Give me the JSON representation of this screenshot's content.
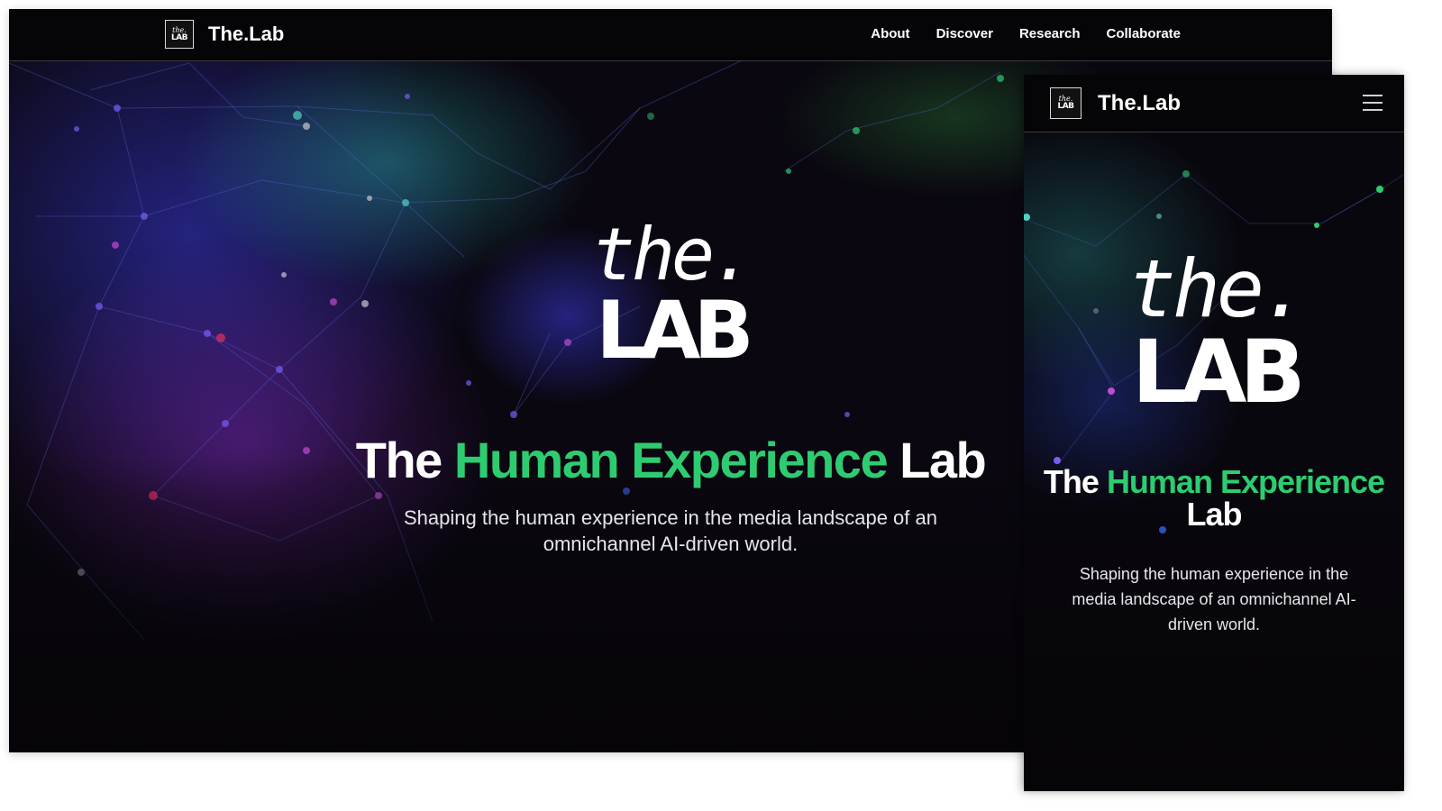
{
  "desktop": {
    "nav": {
      "logo_small_top": "the.",
      "logo_small_bottom": "LAB",
      "brand": "The.Lab",
      "links": [
        "About",
        "Discover",
        "Research",
        "Collaborate"
      ]
    },
    "hero": {
      "logo_top": "the.",
      "logo_bottom": "LAB",
      "headline_part1": "The ",
      "headline_accent": "Human Experience",
      "headline_part2": " Lab",
      "subline": "Shaping the human experience in the media landscape of an omnichannel AI-driven world."
    }
  },
  "mobile": {
    "nav": {
      "logo_small_top": "the.",
      "logo_small_bottom": "LAB",
      "brand": "The.Lab",
      "menu_icon": "hamburger-icon"
    },
    "hero": {
      "logo_top": "the.",
      "logo_bottom": "LAB",
      "headline_part1": "The ",
      "headline_accent": "Human Experience",
      "headline_part2": "Lab",
      "subline": "Shaping the human experience in the media landscape of an omnichannel AI-driven world."
    }
  },
  "colors": {
    "accent": "#2ecc71",
    "background": "#0a0710",
    "nav": "#050407",
    "text": "#ffffff"
  }
}
